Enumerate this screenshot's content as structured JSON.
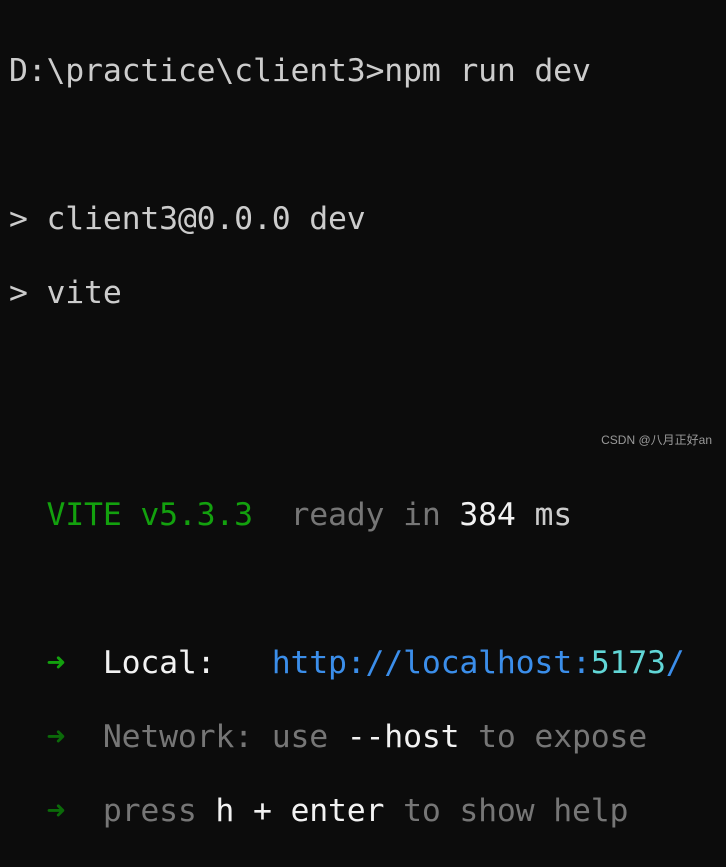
{
  "terminal": {
    "prompt": "D:\\practice\\client3>",
    "command": "npm run dev",
    "script_line1": "> client3@0.0.0 dev",
    "script_line2": "> vite",
    "vite_name": "VITE",
    "vite_version": "v5.3.3",
    "ready_text": "ready in",
    "ready_ms": "384",
    "ms_unit": "ms",
    "arrow": "➜",
    "local_label": "Local:",
    "local_url_base": "http://localhost:",
    "local_url_port": "5173",
    "local_url_slash": "/",
    "network_label": "Network:",
    "network_use": "use",
    "network_flag": "--host",
    "network_rest": "to expose",
    "press_text": "press",
    "press_key": "h + enter",
    "press_rest": "to show help"
  },
  "watermark": "CSDN @八月正好an",
  "colors": {
    "background": "#0c0c0c",
    "green": "#13a10e",
    "url": "#3b8eea",
    "port": "#61d6d6"
  }
}
